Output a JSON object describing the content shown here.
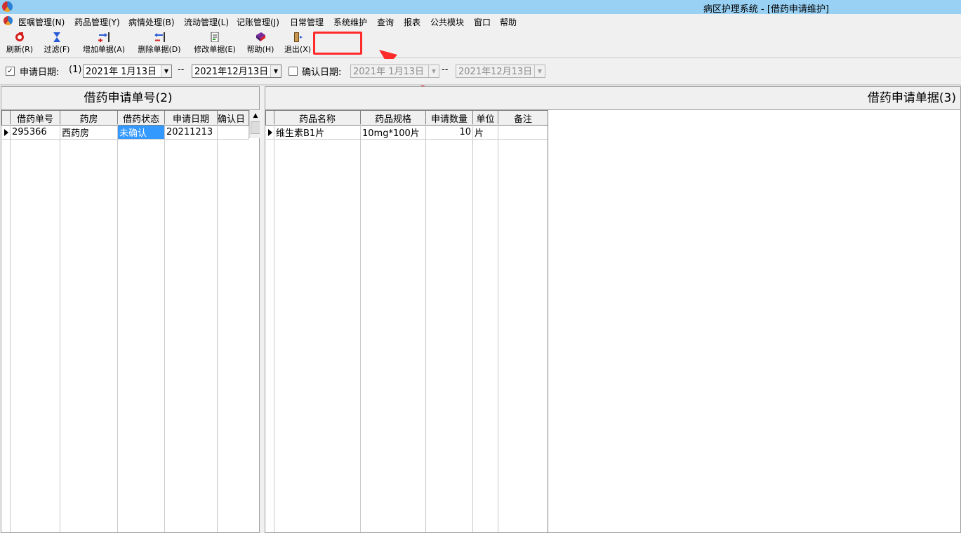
{
  "window": {
    "title": "病区护理系统 - [借药申请维护]"
  },
  "menu": [
    "医嘱管理(N)",
    "药品管理(Y)",
    "病情处理(B)",
    "流动管理(L)",
    "记账管理(J)",
    "日常管理",
    "系统维护",
    "查询",
    "报表",
    "公共模块",
    "窗口",
    "帮助"
  ],
  "toolbar": {
    "refresh": "刷新(R)",
    "filter": "过滤(F)",
    "add": "增加单据(A)",
    "delete": "删除单据(D)",
    "edit": "修改单据(E)",
    "help": "帮助(H)",
    "exit": "退出(X)"
  },
  "filter": {
    "apply_date_label": "申请日期:",
    "apply_date_key": "(1)",
    "apply_date_checked": true,
    "apply_from": "2021年 1月13日",
    "apply_sep": "--",
    "apply_to": "2021年12月13日",
    "confirm_date_label": "确认日期:",
    "confirm_date_checked": false,
    "confirm_from": "2021年  1月13日",
    "confirm_sep": "--",
    "confirm_to": "2021年12月13日"
  },
  "left_panel": {
    "title": "借药申请单号(2)",
    "columns": [
      "借药单号",
      "药房",
      "借药状态",
      "申请日期",
      "确认日"
    ],
    "rows": [
      {
        "id": "295366",
        "pharmacy": "西药房",
        "status": "未确认",
        "date": "20211213",
        "confirm": ""
      }
    ]
  },
  "right_panel": {
    "title": "借药申请单据(3)",
    "columns": [
      "药品名称",
      "药品规格",
      "申请数量",
      "单位",
      "备注"
    ],
    "rows": [
      {
        "name": "维生素B1片",
        "spec": "10mg*100片",
        "qty": "10",
        "unit": "片",
        "note": ""
      }
    ]
  },
  "colors": {
    "titlebar": "#99d1f4",
    "highlight": "#ff2a2a",
    "selection": "#3399ff"
  }
}
